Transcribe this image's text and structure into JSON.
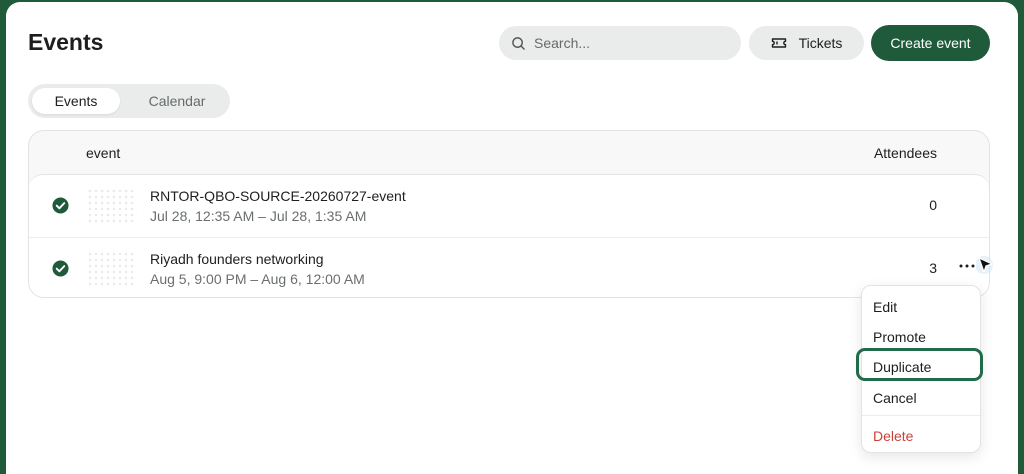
{
  "header": {
    "title": "Events",
    "search_placeholder": "Search...",
    "tickets_label": "Tickets",
    "create_label": "Create event"
  },
  "view_tabs": [
    {
      "label": "Events",
      "active": true
    },
    {
      "label": "Calendar",
      "active": false
    }
  ],
  "table": {
    "columns": {
      "event": "event",
      "attendees": "Attendees"
    },
    "rows": [
      {
        "name": "RNTOR-QBO-SOURCE-20260727-event",
        "date": "Jul 28, 12:35 AM – Jul 28, 1:35 AM",
        "attendees": "0",
        "status_icon": "check-circle-icon"
      },
      {
        "name": "Riyadh founders networking",
        "date": "Aug 5, 9:00 PM – Aug 6, 12:00 AM",
        "attendees": "3",
        "status_icon": "check-circle-icon"
      }
    ]
  },
  "row_menu": {
    "items": [
      {
        "label": "Edit"
      },
      {
        "label": "Promote"
      },
      {
        "label": "Duplicate",
        "highlighted": true
      },
      {
        "label": "Cancel"
      },
      {
        "label": "Delete",
        "danger": true
      }
    ]
  },
  "colors": {
    "brand": "#1f5a3a",
    "danger": "#c9423a",
    "pill_bg": "#e9ecea"
  }
}
